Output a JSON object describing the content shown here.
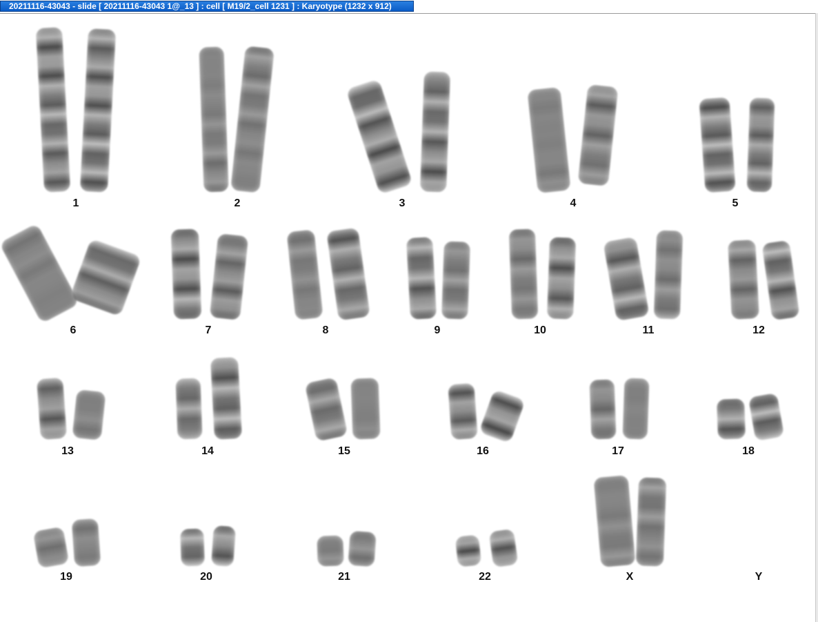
{
  "window": {
    "title": "20211116-43043 - slide [ 20211116-43043 1@_13 ] : cell [ M19/2_cell 1231 ] : Karyotype  (1232 x 912)"
  },
  "karyotype": {
    "labels": [
      "1",
      "2",
      "3",
      "4",
      "5",
      "6",
      "7",
      "8",
      "9",
      "10",
      "11",
      "12",
      "13",
      "14",
      "15",
      "16",
      "17",
      "18",
      "19",
      "20",
      "21",
      "22",
      "X",
      "Y"
    ]
  }
}
